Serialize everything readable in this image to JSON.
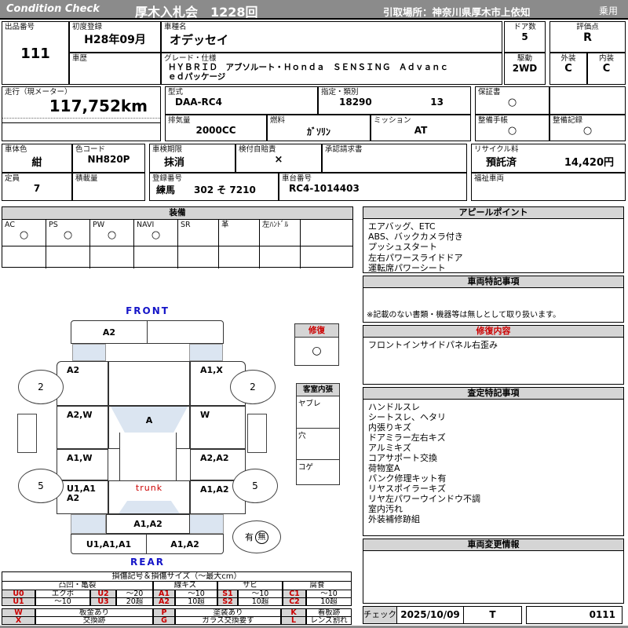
{
  "header": {
    "brand": "Condition  Check",
    "auction": "厚木入札会　1228回",
    "pickup": "引取場所：神奈川県厚木市上依知",
    "category": "乗用"
  },
  "info": {
    "lot": {
      "label": "出品番号",
      "value": "111"
    },
    "first_reg": {
      "label": "初度登録",
      "value": "H28年09月"
    },
    "history": {
      "label": "車歴",
      "value": ""
    },
    "model": {
      "label": "車種名",
      "value": "オデッセイ"
    },
    "grade": {
      "label": "グレード・仕様",
      "line1": "ＨＹＢＲＩＤ　アブソルート・Ｈｏｎｄａ　ＳＥＮＳＩＮＧ　Ａｄｖａｎｃ",
      "line2": "ｅｄパッケージ"
    },
    "doors": {
      "label": "ドア数",
      "value": "5"
    },
    "drive": {
      "label": "駆動",
      "value": "2WD"
    },
    "score": {
      "label": "評価点",
      "value": "R"
    },
    "exterior": {
      "label": "外装",
      "value": "C"
    },
    "interior": {
      "label": "内装",
      "value": "C"
    },
    "mileage": {
      "label": "走行（現メーター）",
      "value": "117,752km"
    },
    "model_code": {
      "label": "型式",
      "value": "DAA-RC4"
    },
    "designation": {
      "label": "指定・類別",
      "no1": "18290",
      "no2": "13"
    },
    "warranty": {
      "label": "保証書",
      "value": "○"
    },
    "displacement": {
      "label": "排気量",
      "value": "2000CC"
    },
    "fuel": {
      "label": "燃料",
      "value": "ｶﾞｿﾘﾝ"
    },
    "transmission": {
      "label": "ミッション",
      "value": "AT"
    },
    "maint_book": {
      "label": "整備手帳",
      "value": "○"
    },
    "maint_record": {
      "label": "整備記録",
      "value": "○"
    },
    "body_color": {
      "label": "車体色",
      "value": "紺"
    },
    "color_code": {
      "label": "色コード",
      "value": "NH820P"
    },
    "inspection": {
      "label": "車検期限",
      "value": "抹消"
    },
    "jibaiseki": {
      "label": "検付自賠責",
      "value": "×"
    },
    "approval": {
      "label": "承認請求書",
      "value": ""
    },
    "recycle": {
      "label": "リサイクル料",
      "status": "預託済",
      "fee": "14,420円"
    },
    "capacity": {
      "label": "定員",
      "value": "7"
    },
    "payload": {
      "label": "積載量",
      "value": ""
    },
    "reg_number": {
      "label": "登録番号",
      "value": "練馬　　302 そ 7210"
    },
    "chassis": {
      "label": "車台番号",
      "value": "RC4-1014403"
    },
    "welfare": {
      "label": "福祉車両",
      "value": ""
    }
  },
  "equipment": {
    "title": "装備",
    "items": [
      {
        "label": "AC",
        "value": "○"
      },
      {
        "label": "PS",
        "value": "○"
      },
      {
        "label": "PW",
        "value": "○"
      },
      {
        "label": "NAVI",
        "value": "○"
      },
      {
        "label": "SR",
        "value": ""
      },
      {
        "label": "革",
        "value": ""
      },
      {
        "label": "左ﾊﾝﾄﾞﾙ",
        "value": ""
      },
      {
        "label": "",
        "value": ""
      }
    ]
  },
  "appeal": {
    "title": "アピールポイント",
    "lines": [
      "エアバッグ、ETC",
      "ABS、バックカメラ付き",
      "プッシュスタート",
      "左右パワースライドドア",
      "運転席パワーシート"
    ]
  },
  "vehicle_notes": {
    "title": "車両特記事項",
    "disclaimer": "※記載のない書類・機器等は無しとして取り扱います。"
  },
  "repair_details": {
    "title": "修復内容",
    "lines": [
      "フロントインサイドパネル右歪み"
    ]
  },
  "assessment": {
    "title": "査定特記事項",
    "lines": [
      "ハンドルスレ",
      "シートスレ、ヘタリ",
      "内張りキズ",
      "ドアミラー左右キズ",
      "アルミキズ",
      "コアサポート交換",
      "荷物室A",
      "パンク修理キット有",
      "リヤスポイラーキズ",
      "リヤ左パワーウインドウ不調",
      "室内汚れ",
      "外装補修跡組"
    ]
  },
  "change_info": {
    "title": "車両変更情報"
  },
  "check": {
    "label": "チェック",
    "date": "2025/10/09",
    "inspector": "T",
    "number": "0111"
  },
  "diagram": {
    "front": "FRONT",
    "rear": "REAR",
    "trunk": "trunk",
    "repair_flag": {
      "title": "修復",
      "mark": "○"
    },
    "interior_box": {
      "title": "客室内張",
      "row1": "ヤブレ",
      "row2": "穴",
      "row3": "コゲ"
    },
    "front_bumper_left": "A2",
    "front_bumper_right": "",
    "fender_left": "A2",
    "fender_right": "A1,X",
    "door_front_left": "A2,W",
    "roof": "A",
    "door_front_right": "W",
    "door_rear_left": "A1,W",
    "door_rear_right": "A2,A2",
    "quarter_left_1": "U1,A1",
    "quarter_left_2": "A2",
    "quarter_right": "A1,A2",
    "tailgate": "A1,A2",
    "rear_bumper_left": "U1,A1,A1",
    "rear_bumper_right": "A1,A2",
    "tire_front_left": "2",
    "tire_front_right": "2",
    "tire_rear_left": "5",
    "tire_rear_right": "5",
    "spare_has": "有",
    "spare_none": "無"
  },
  "legend": {
    "title": "損傷記号＆損傷サイズ（～最大cm）",
    "groups": [
      "凸凹・亀裂",
      "線キズ",
      "サビ",
      "腐食"
    ],
    "row1": [
      "U0",
      "エクボ",
      "U2",
      "～20",
      "A1",
      "～10",
      "S1",
      "～10",
      "C1",
      "～10"
    ],
    "row2": [
      "U1",
      "～10",
      "U3",
      "20超",
      "A2",
      "10超",
      "S2",
      "10超",
      "C2",
      "10超"
    ],
    "marks1": [
      "W",
      "板金あり",
      "P",
      "塗装あり",
      "K",
      "看板跡"
    ],
    "marks2": [
      "X",
      "交換跡",
      "G",
      "ガラス交換要す",
      "L",
      "レンズ割れ"
    ]
  },
  "colors": {
    "header_gray": "#8b8b8b",
    "panel_gray": "#d5d5d5",
    "shade_blue": "#dbe5f1",
    "accent_red": "#cc0000",
    "accent_blue": "#1515c8"
  }
}
